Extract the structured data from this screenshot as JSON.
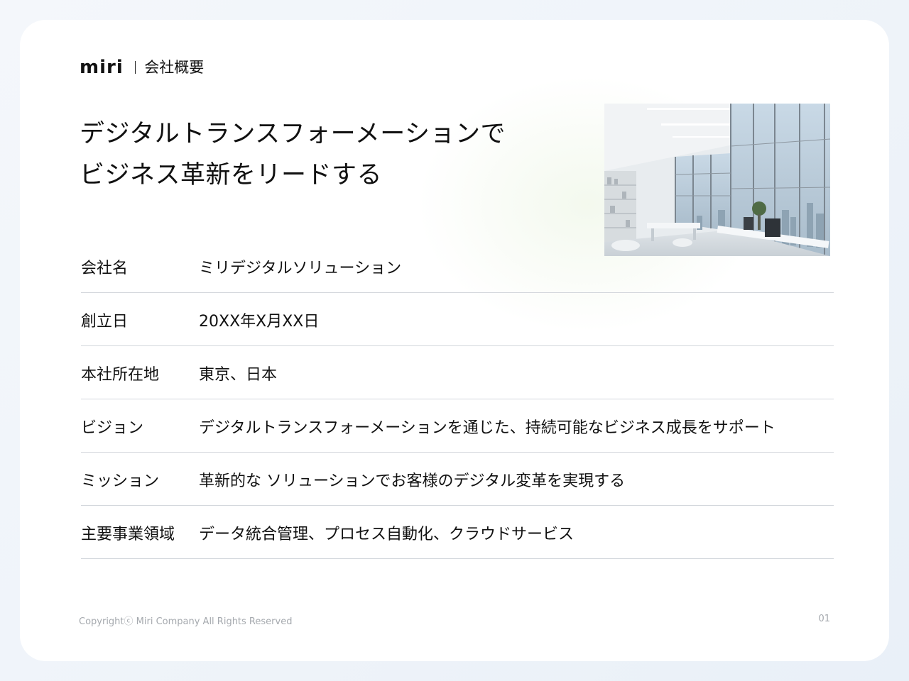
{
  "header": {
    "logo": "miri",
    "title": "会社概要"
  },
  "headline": {
    "line1": "デジタルトランスフォーメーションで",
    "line2": "ビジネス革新をリードする"
  },
  "profile": [
    {
      "label": "会社名",
      "value": "ミリデジタルソリューション"
    },
    {
      "label": "創立日",
      "value": "20XX年X月XX日"
    },
    {
      "label": "本社所在地",
      "value": "東京、日本"
    },
    {
      "label": "ビジョン",
      "value": "デジタルトランスフォーメーションを通じた、持続可能なビジネス成長をサポート"
    },
    {
      "label": "ミッション",
      "value": "革新的な ソリューションでお客様のデジタル変革を実現する"
    },
    {
      "label": "主要事業領域",
      "value": "データ統合管理、プロセス自動化、クラウドサービス"
    }
  ],
  "footer": {
    "copyright": "Copyrightⓒ Miri Company All Rights Reserved",
    "page": "01"
  }
}
